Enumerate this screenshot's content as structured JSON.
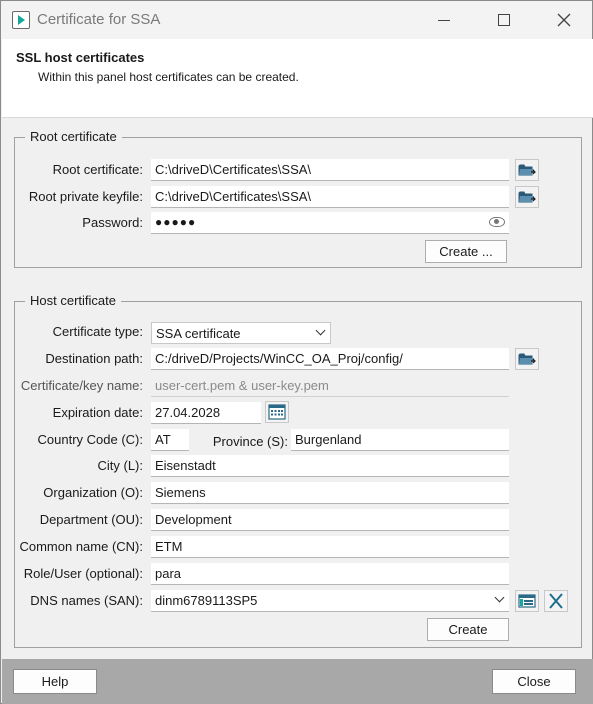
{
  "window": {
    "title": "Certificate for SSA"
  },
  "header": {
    "title": "SSL host certificates",
    "subtitle": "Within this panel host certificates can be created."
  },
  "root_group": {
    "legend": "Root certificate",
    "root_certificate_label": "Root certificate:",
    "root_certificate_value": "C:\\driveD\\Certificates\\SSA\\",
    "root_keyfile_label": "Root private keyfile:",
    "root_keyfile_value": "C:\\driveD\\Certificates\\SSA\\",
    "password_label": "Password:",
    "password_value": "●●●●●",
    "create_button": "Create ..."
  },
  "host_group": {
    "legend": "Host certificate",
    "certificate_type_label": "Certificate type:",
    "certificate_type_value": "SSA certificate",
    "destination_label": "Destination path:",
    "destination_value": "C:/driveD/Projects/WinCC_OA_Proj/config/",
    "keyname_label": "Certificate/key name:",
    "keyname_value": "user-cert.pem & user-key.pem",
    "expiration_label": "Expiration date:",
    "expiration_value": "27.04.2028",
    "country_label": "Country Code (C):",
    "country_value": "AT",
    "province_label": "Province (S):",
    "province_value": "Burgenland",
    "city_label": "City (L):",
    "city_value": "Eisenstadt",
    "organization_label": "Organization (O):",
    "organization_value": "Siemens",
    "department_label": "Department (OU):",
    "department_value": "Development",
    "common_name_label": "Common name (CN):",
    "common_name_value": "ETM",
    "role_label": "Role/User (optional):",
    "role_value": "para",
    "dns_label": "DNS names (SAN):",
    "dns_value": "dinm6789113SP5",
    "create_button": "Create"
  },
  "footer": {
    "help_button": "Help",
    "close_button": "Close"
  },
  "icons": {
    "app": "app-play-icon",
    "folder": "folder-browse-icon",
    "eye": "show-password-eye-icon",
    "calendar": "calendar-icon",
    "add": "add-entry-icon",
    "clear": "clear-x-icon"
  },
  "colors": {
    "accent": "#14a89a",
    "footer_bar": "#a8a8a8",
    "panel_bg": "#f0f0f0"
  }
}
